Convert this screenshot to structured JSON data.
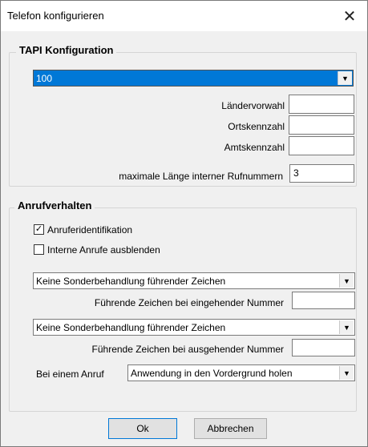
{
  "window": {
    "title": "Telefon konfigurieren",
    "close_glyph": "✕"
  },
  "tapi": {
    "group_title": "TAPI Konfiguration",
    "line_select": "100",
    "laendervorwahl_label": "Ländervorwahl",
    "laendervorwahl_value": "",
    "ortskennzahl_label": "Ortskennzahl",
    "ortskennzahl_value": "",
    "amtskennzahl_label": "Amtskennzahl",
    "amtskennzahl_value": "",
    "max_laenge_label": "maximale Länge interner Rufnummern",
    "max_laenge_value": "3"
  },
  "anruf": {
    "group_title": "Anrufverhalten",
    "anruferidentifikation_label": "Anruferidentifikation",
    "anruferidentifikation_checked": true,
    "check_glyph": "✓",
    "interne_label": "Interne Anrufe ausblenden",
    "interne_checked": false,
    "eingehend_select": "Keine Sonderbehandlung führender Zeichen",
    "eingehend_label": "Führende Zeichen bei eingehender Nummer",
    "eingehend_value": "",
    "ausgehend_select": "Keine Sonderbehandlung führender Zeichen",
    "ausgehend_label": "Führende Zeichen bei ausgehender Nummer",
    "ausgehend_value": "",
    "bei_anruf_label": "Bei einem Anruf",
    "bei_anruf_select": "Anwendung in den Vordergrund holen"
  },
  "buttons": {
    "ok": "Ok",
    "cancel": "Abbrechen"
  },
  "dropdown_arrow_glyph": "▼",
  "colors": {
    "selection": "#0078d7",
    "background": "#f0f0f0"
  }
}
